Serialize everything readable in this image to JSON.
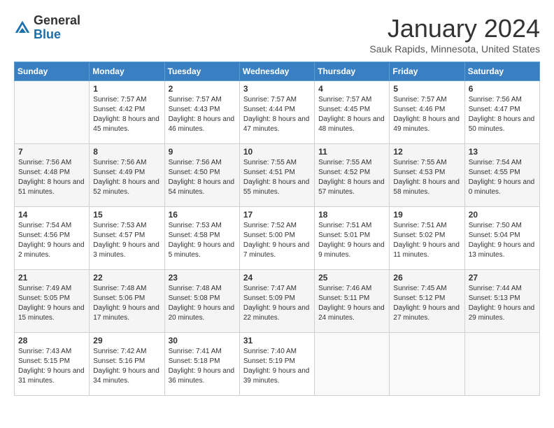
{
  "header": {
    "logo_line1": "General",
    "logo_line2": "Blue",
    "month_title": "January 2024",
    "location": "Sauk Rapids, Minnesota, United States"
  },
  "days_of_week": [
    "Sunday",
    "Monday",
    "Tuesday",
    "Wednesday",
    "Thursday",
    "Friday",
    "Saturday"
  ],
  "weeks": [
    [
      {
        "day": "",
        "sunrise": "",
        "sunset": "",
        "daylight": ""
      },
      {
        "day": "1",
        "sunrise": "Sunrise: 7:57 AM",
        "sunset": "Sunset: 4:42 PM",
        "daylight": "Daylight: 8 hours and 45 minutes."
      },
      {
        "day": "2",
        "sunrise": "Sunrise: 7:57 AM",
        "sunset": "Sunset: 4:43 PM",
        "daylight": "Daylight: 8 hours and 46 minutes."
      },
      {
        "day": "3",
        "sunrise": "Sunrise: 7:57 AM",
        "sunset": "Sunset: 4:44 PM",
        "daylight": "Daylight: 8 hours and 47 minutes."
      },
      {
        "day": "4",
        "sunrise": "Sunrise: 7:57 AM",
        "sunset": "Sunset: 4:45 PM",
        "daylight": "Daylight: 8 hours and 48 minutes."
      },
      {
        "day": "5",
        "sunrise": "Sunrise: 7:57 AM",
        "sunset": "Sunset: 4:46 PM",
        "daylight": "Daylight: 8 hours and 49 minutes."
      },
      {
        "day": "6",
        "sunrise": "Sunrise: 7:56 AM",
        "sunset": "Sunset: 4:47 PM",
        "daylight": "Daylight: 8 hours and 50 minutes."
      }
    ],
    [
      {
        "day": "7",
        "sunrise": "Sunrise: 7:56 AM",
        "sunset": "Sunset: 4:48 PM",
        "daylight": "Daylight: 8 hours and 51 minutes."
      },
      {
        "day": "8",
        "sunrise": "Sunrise: 7:56 AM",
        "sunset": "Sunset: 4:49 PM",
        "daylight": "Daylight: 8 hours and 52 minutes."
      },
      {
        "day": "9",
        "sunrise": "Sunrise: 7:56 AM",
        "sunset": "Sunset: 4:50 PM",
        "daylight": "Daylight: 8 hours and 54 minutes."
      },
      {
        "day": "10",
        "sunrise": "Sunrise: 7:55 AM",
        "sunset": "Sunset: 4:51 PM",
        "daylight": "Daylight: 8 hours and 55 minutes."
      },
      {
        "day": "11",
        "sunrise": "Sunrise: 7:55 AM",
        "sunset": "Sunset: 4:52 PM",
        "daylight": "Daylight: 8 hours and 57 minutes."
      },
      {
        "day": "12",
        "sunrise": "Sunrise: 7:55 AM",
        "sunset": "Sunset: 4:53 PM",
        "daylight": "Daylight: 8 hours and 58 minutes."
      },
      {
        "day": "13",
        "sunrise": "Sunrise: 7:54 AM",
        "sunset": "Sunset: 4:55 PM",
        "daylight": "Daylight: 9 hours and 0 minutes."
      }
    ],
    [
      {
        "day": "14",
        "sunrise": "Sunrise: 7:54 AM",
        "sunset": "Sunset: 4:56 PM",
        "daylight": "Daylight: 9 hours and 2 minutes."
      },
      {
        "day": "15",
        "sunrise": "Sunrise: 7:53 AM",
        "sunset": "Sunset: 4:57 PM",
        "daylight": "Daylight: 9 hours and 3 minutes."
      },
      {
        "day": "16",
        "sunrise": "Sunrise: 7:53 AM",
        "sunset": "Sunset: 4:58 PM",
        "daylight": "Daylight: 9 hours and 5 minutes."
      },
      {
        "day": "17",
        "sunrise": "Sunrise: 7:52 AM",
        "sunset": "Sunset: 5:00 PM",
        "daylight": "Daylight: 9 hours and 7 minutes."
      },
      {
        "day": "18",
        "sunrise": "Sunrise: 7:51 AM",
        "sunset": "Sunset: 5:01 PM",
        "daylight": "Daylight: 9 hours and 9 minutes."
      },
      {
        "day": "19",
        "sunrise": "Sunrise: 7:51 AM",
        "sunset": "Sunset: 5:02 PM",
        "daylight": "Daylight: 9 hours and 11 minutes."
      },
      {
        "day": "20",
        "sunrise": "Sunrise: 7:50 AM",
        "sunset": "Sunset: 5:04 PM",
        "daylight": "Daylight: 9 hours and 13 minutes."
      }
    ],
    [
      {
        "day": "21",
        "sunrise": "Sunrise: 7:49 AM",
        "sunset": "Sunset: 5:05 PM",
        "daylight": "Daylight: 9 hours and 15 minutes."
      },
      {
        "day": "22",
        "sunrise": "Sunrise: 7:48 AM",
        "sunset": "Sunset: 5:06 PM",
        "daylight": "Daylight: 9 hours and 17 minutes."
      },
      {
        "day": "23",
        "sunrise": "Sunrise: 7:48 AM",
        "sunset": "Sunset: 5:08 PM",
        "daylight": "Daylight: 9 hours and 20 minutes."
      },
      {
        "day": "24",
        "sunrise": "Sunrise: 7:47 AM",
        "sunset": "Sunset: 5:09 PM",
        "daylight": "Daylight: 9 hours and 22 minutes."
      },
      {
        "day": "25",
        "sunrise": "Sunrise: 7:46 AM",
        "sunset": "Sunset: 5:11 PM",
        "daylight": "Daylight: 9 hours and 24 minutes."
      },
      {
        "day": "26",
        "sunrise": "Sunrise: 7:45 AM",
        "sunset": "Sunset: 5:12 PM",
        "daylight": "Daylight: 9 hours and 27 minutes."
      },
      {
        "day": "27",
        "sunrise": "Sunrise: 7:44 AM",
        "sunset": "Sunset: 5:13 PM",
        "daylight": "Daylight: 9 hours and 29 minutes."
      }
    ],
    [
      {
        "day": "28",
        "sunrise": "Sunrise: 7:43 AM",
        "sunset": "Sunset: 5:15 PM",
        "daylight": "Daylight: 9 hours and 31 minutes."
      },
      {
        "day": "29",
        "sunrise": "Sunrise: 7:42 AM",
        "sunset": "Sunset: 5:16 PM",
        "daylight": "Daylight: 9 hours and 34 minutes."
      },
      {
        "day": "30",
        "sunrise": "Sunrise: 7:41 AM",
        "sunset": "Sunset: 5:18 PM",
        "daylight": "Daylight: 9 hours and 36 minutes."
      },
      {
        "day": "31",
        "sunrise": "Sunrise: 7:40 AM",
        "sunset": "Sunset: 5:19 PM",
        "daylight": "Daylight: 9 hours and 39 minutes."
      },
      {
        "day": "",
        "sunrise": "",
        "sunset": "",
        "daylight": ""
      },
      {
        "day": "",
        "sunrise": "",
        "sunset": "",
        "daylight": ""
      },
      {
        "day": "",
        "sunrise": "",
        "sunset": "",
        "daylight": ""
      }
    ]
  ]
}
